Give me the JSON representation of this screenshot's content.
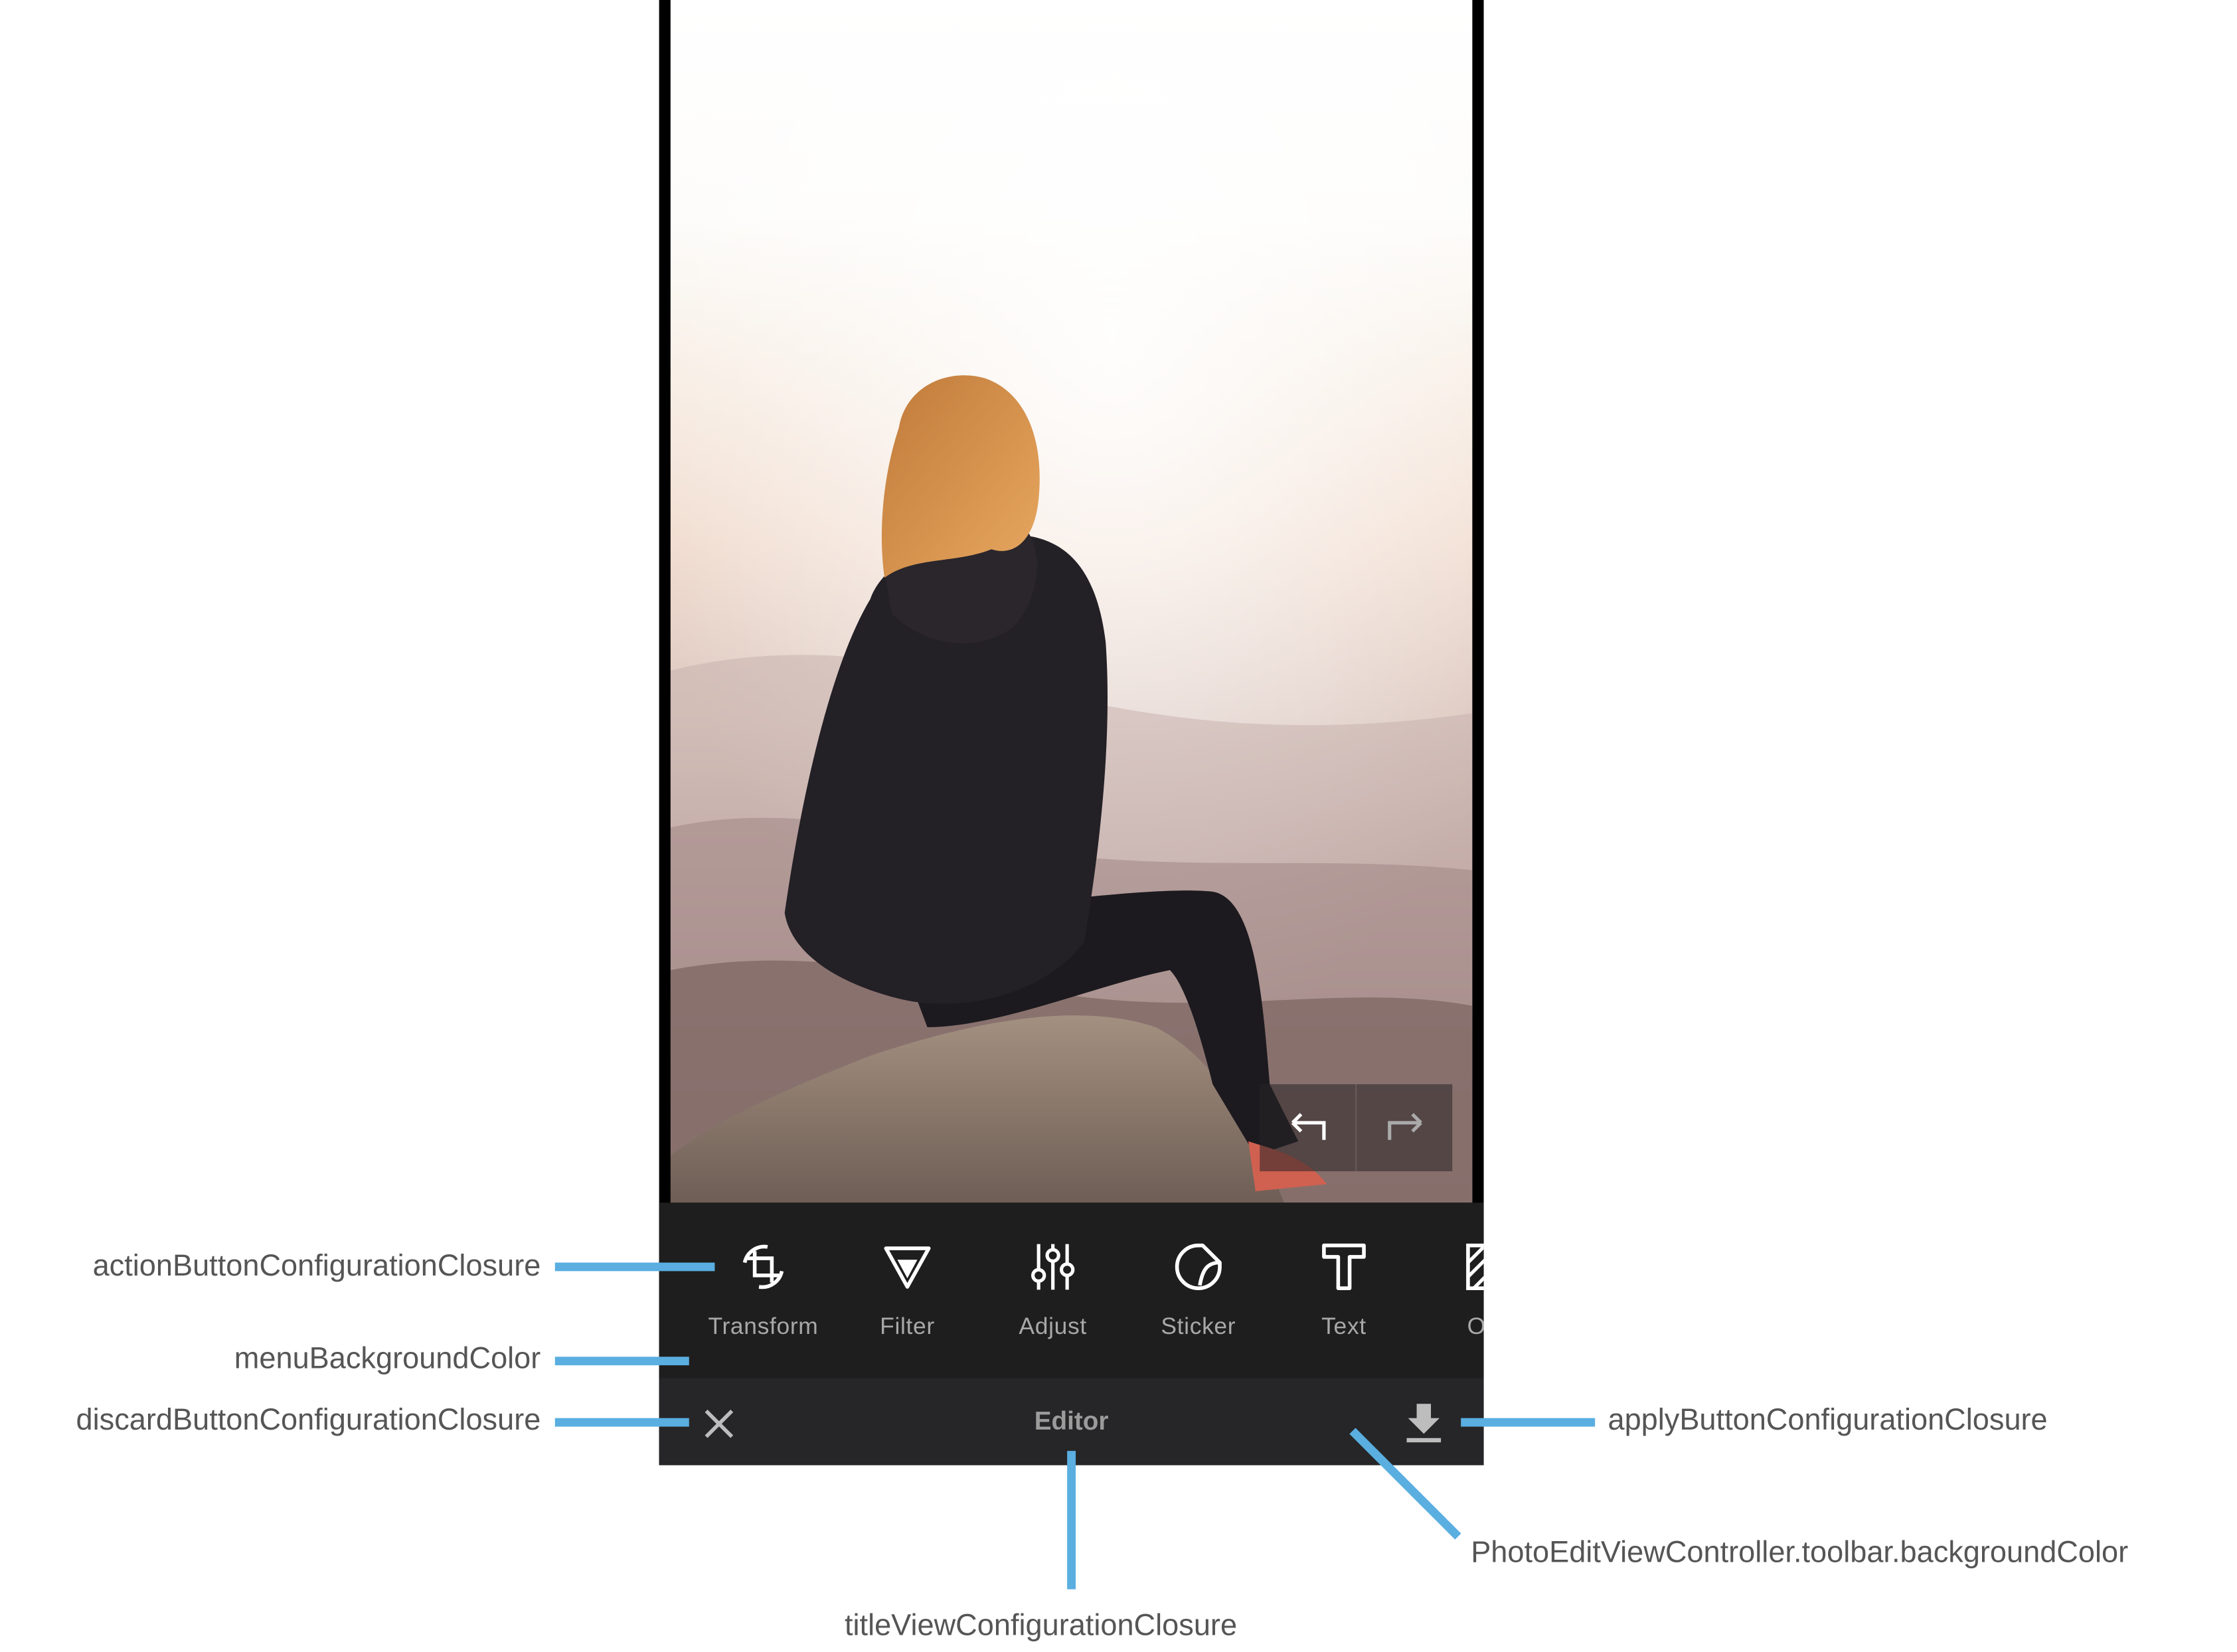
{
  "editor": {
    "undo_icon": "undo-arrow-icon",
    "redo_icon": "redo-arrow-icon",
    "menu": {
      "items": [
        {
          "label": "Transform",
          "icon": "transform-crop-icon"
        },
        {
          "label": "Filter",
          "icon": "filter-triangle-icon"
        },
        {
          "label": "Adjust",
          "icon": "adjust-sliders-icon"
        },
        {
          "label": "Sticker",
          "icon": "sticker-icon"
        },
        {
          "label": "Text",
          "icon": "text-t-icon"
        },
        {
          "label": "Ove",
          "icon": "overlay-icon"
        }
      ]
    },
    "toolbar": {
      "discard_icon": "close-x-icon",
      "title": "Editor",
      "apply_icon": "download-apply-icon"
    }
  },
  "callouts": {
    "action_button": "actionButtonConfigurationClosure",
    "menu_background": "menuBackgroundColor",
    "discard_button": "discardButtonConfigurationClosure",
    "apply_button": "applyButtonConfigurationClosure",
    "toolbar_background": "PhotoEditViewController.toolbar.backgroundColor",
    "title_view": "titleViewConfigurationClosure"
  },
  "colors": {
    "callout_line": "#5aaee0",
    "menu_background": "#1e1e1e",
    "toolbar_background": "#262628",
    "label_text": "#a8a8a8"
  }
}
